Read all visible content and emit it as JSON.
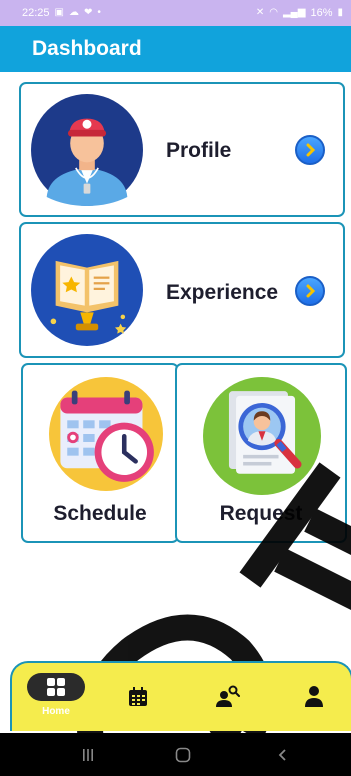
{
  "status_bar": {
    "time": "22:25",
    "battery": "16%"
  },
  "header": {
    "title": "Dashboard"
  },
  "cards": {
    "profile": {
      "label": "Profile",
      "icon": "coach-avatar-icon"
    },
    "experience": {
      "label": "Experience",
      "icon": "open-book-trophy-icon"
    },
    "schedule": {
      "label": "Schedule",
      "icon": "calendar-clock-icon"
    },
    "request": {
      "label": "Request",
      "icon": "document-search-person-icon"
    }
  },
  "bottom_nav": {
    "items": [
      {
        "label": "Home",
        "icon": "grid-icon",
        "active": true
      },
      {
        "icon": "calendar-icon"
      },
      {
        "icon": "person-search-icon"
      },
      {
        "icon": "person-icon"
      }
    ]
  },
  "colors": {
    "status_bar": "#c9b4ef",
    "app_bar": "#11a3dc",
    "card_border": "#1b94b7",
    "bottom_nav": "#f5ec4d"
  }
}
